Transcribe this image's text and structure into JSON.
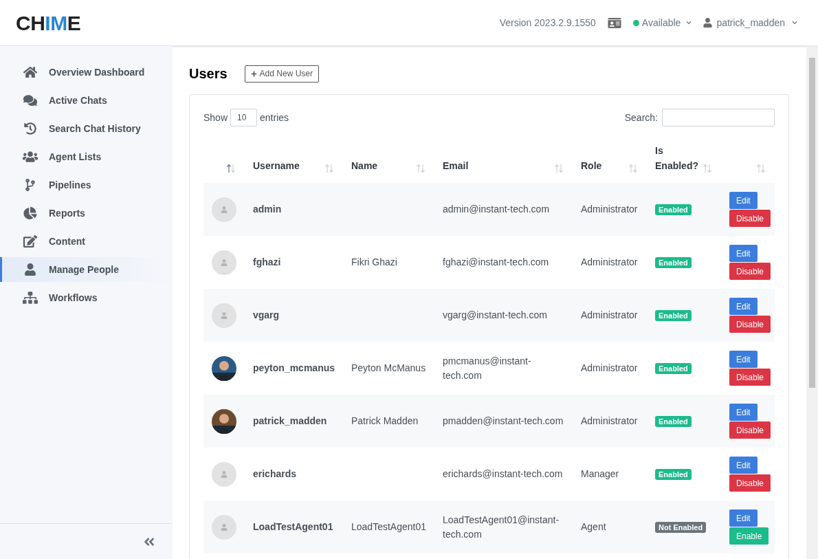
{
  "header": {
    "logo_dark": "CH",
    "logo_accent": "IM",
    "logo_end": "E",
    "version": "Version 2023.2.9.1550",
    "status": {
      "label": "Available",
      "color": "#1fbf7f"
    },
    "user": "patrick_madden"
  },
  "sidebar": {
    "items": [
      {
        "label": "Overview Dashboard",
        "selected": false
      },
      {
        "label": "Active Chats",
        "selected": false
      },
      {
        "label": "Search Chat History",
        "selected": false
      },
      {
        "label": "Agent Lists",
        "selected": false
      },
      {
        "label": "Pipelines",
        "selected": false
      },
      {
        "label": "Reports",
        "selected": false
      },
      {
        "label": "Content",
        "selected": false
      },
      {
        "label": "Manage People",
        "selected": true
      },
      {
        "label": "Workflows",
        "selected": false
      }
    ]
  },
  "page": {
    "title": "Users",
    "add_button": "Add New User"
  },
  "table": {
    "show_label": "Show",
    "page_size": "10",
    "entries_label": "entries",
    "search_label": "Search:",
    "columns": [
      {
        "sorted": true
      },
      {
        "label": "Username",
        "sorted": false
      },
      {
        "label": "Name",
        "sorted": false
      },
      {
        "label": "Email",
        "sorted": false
      },
      {
        "label": "Role",
        "sorted": false
      },
      {
        "label": "Is Enabled?",
        "sorted": false
      },
      {
        "sorted": false
      }
    ],
    "rows": [
      {
        "avatar": {
          "kind": "placeholder"
        },
        "username": "admin",
        "email": "admin@instant-tech.com",
        "role": "Administrator",
        "enabled": true,
        "status": "Enabled",
        "actions": [
          {
            "label": "Edit",
            "kind": "edit"
          },
          {
            "label": "Disable",
            "kind": "disable"
          }
        ]
      },
      {
        "avatar": {
          "kind": "placeholder"
        },
        "username": "fghazi",
        "name": "Fikri Ghazi",
        "email": "fghazi@instant-tech.com",
        "role": "Administrator",
        "enabled": true,
        "status": "Enabled",
        "actions": [
          {
            "label": "Edit",
            "kind": "edit"
          },
          {
            "label": "Disable",
            "kind": "disable"
          }
        ]
      },
      {
        "avatar": {
          "kind": "placeholder"
        },
        "username": "vgarg",
        "email": "vgarg@instant-tech.com",
        "role": "Administrator",
        "enabled": true,
        "status": "Enabled",
        "actions": [
          {
            "label": "Edit",
            "kind": "edit"
          },
          {
            "label": "Disable",
            "kind": "disable"
          }
        ]
      },
      {
        "username": "peyton_mcmanus",
        "name": "Peyton McManus",
        "email": "pmcmanus@instant-tech.com",
        "role": "Administrator",
        "enabled": true,
        "status": "Enabled",
        "actions": [
          {
            "label": "Edit",
            "kind": "edit"
          },
          {
            "label": "Disable",
            "kind": "disable"
          }
        ]
      },
      {
        "username": "patrick_madden",
        "name": "Patrick Madden",
        "email": "pmadden@instant-tech.com",
        "role": "Administrator",
        "enabled": true,
        "status": "Enabled",
        "actions": [
          {
            "label": "Edit",
            "kind": "edit"
          },
          {
            "label": "Disable",
            "kind": "disable"
          }
        ]
      },
      {
        "avatar": {
          "kind": "placeholder"
        },
        "username": "erichards",
        "email": "erichards@instant-tech.com",
        "role": "Manager",
        "enabled": true,
        "status": "Enabled",
        "actions": [
          {
            "label": "Edit",
            "kind": "edit"
          },
          {
            "label": "Disable",
            "kind": "disable"
          }
        ]
      },
      {
        "avatar": {
          "kind": "placeholder"
        },
        "username": "LoadTestAgent01",
        "name": "LoadTestAgent01",
        "email": "LoadTestAgent01@instant-tech.com",
        "role": "Agent",
        "enabled": false,
        "status": "Not Enabled",
        "actions": [
          {
            "label": "Edit",
            "kind": "edit"
          },
          {
            "label": "Enable",
            "kind": "enable"
          }
        ]
      }
    ]
  }
}
